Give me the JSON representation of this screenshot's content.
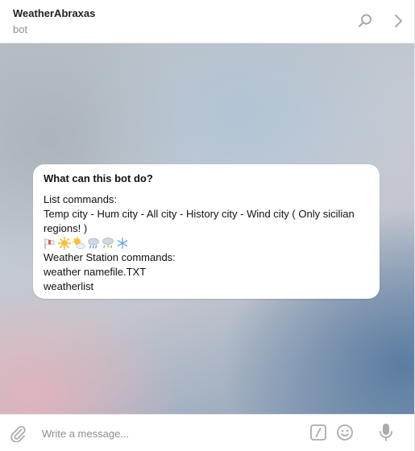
{
  "header": {
    "title": "WeatherAbraxas",
    "subtitle": "bot",
    "icons": [
      "search-icon",
      "chevron-right-icon"
    ]
  },
  "bot_info": {
    "heading": "What can this bot do?",
    "lines": [
      "List commands:",
      "Temp city - Hum city - All city - History city - Wind city ( Only sicilian regions! )",
      "Weather Station commands:",
      "weather namefile.TXT",
      "weatherlist"
    ],
    "emojis": [
      "windsock-icon",
      "sun-icon",
      "sun-behind-cloud-icon",
      "cloud-with-rain-icon",
      "thunder-cloud-rain-icon",
      "snowflake-icon"
    ]
  },
  "composer": {
    "placeholder": "Write a message...",
    "icons": [
      "paperclip-icon",
      "bot-command-icon",
      "emoji-icon",
      "microphone-icon"
    ]
  },
  "colors": {
    "icon_gray": "#a7acb1",
    "text_muted": "#8a8f94",
    "card_bg": "#ffffff"
  }
}
